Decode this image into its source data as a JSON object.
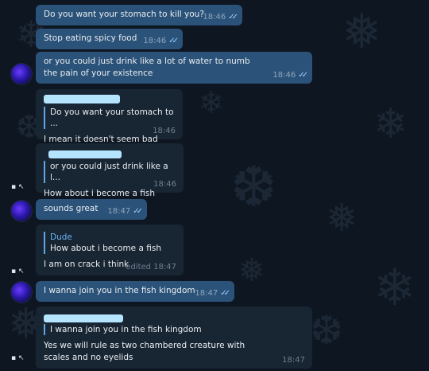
{
  "messages": [
    {
      "text": "Do you want your stomach to kill you?",
      "time": "18:46"
    },
    {
      "text": "Stop eating spicy food",
      "time": "18:46"
    },
    {
      "text": "or you could just drink like a lot of water to numb the pain of your existence",
      "time": "18:46"
    },
    {
      "reply_text": "Do you want your stomach to ...",
      "text": "I mean it doesn't seem bad",
      "time": "18:46"
    },
    {
      "reply_text": "or you could just drink like a l...",
      "text": "How about i become a fish",
      "time": "18:46"
    },
    {
      "text": "sounds great",
      "time": "18:47"
    },
    {
      "reply_name": "Dude",
      "reply_text": "How about i become a fish",
      "text": "I am on crack i think",
      "time": "edited 18:47"
    },
    {
      "text": "I wanna join you in the fish kingdom",
      "time": "18:47"
    },
    {
      "reply_text": "I wanna join you in the fish kingdom",
      "text": "Yes we will rule as two chambered creature with scales and no eyelids",
      "time": "18:47"
    }
  ],
  "colors": {
    "outgoing_bubble": "#2b5278",
    "incoming_bubble": "#182533",
    "background": "#0e1621",
    "accent": "#6ab3f3"
  },
  "icons": [
    "double-check-icon",
    "avatar"
  ]
}
